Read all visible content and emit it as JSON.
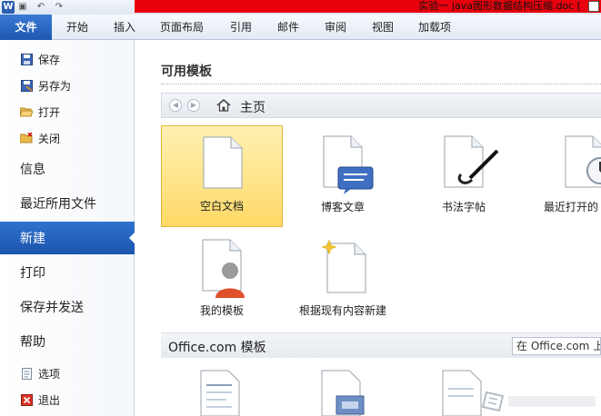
{
  "window": {
    "app_icon_letter": "W",
    "title": "实验一 java图形数据结构压缩.doc [",
    "accent_red": "#e8000c"
  },
  "quick_access": [
    "save-icon",
    "undo-icon",
    "redo-icon"
  ],
  "ribbon": {
    "tabs": [
      "文件",
      "开始",
      "插入",
      "页面布局",
      "引用",
      "邮件",
      "审阅",
      "视图",
      "加载项"
    ]
  },
  "sidebar": {
    "top_items": [
      {
        "label": "保存",
        "icon": "save-icon"
      },
      {
        "label": "另存为",
        "icon": "save-as-icon"
      },
      {
        "label": "打开",
        "icon": "open-folder-icon"
      },
      {
        "label": "关闭",
        "icon": "close-folder-icon"
      }
    ],
    "sections": [
      "信息",
      "最近所用文件",
      "新建",
      "打印",
      "保存并发送",
      "帮助"
    ],
    "active": "新建",
    "bottom_items": [
      {
        "label": "选项",
        "icon": "options-icon"
      },
      {
        "label": "退出",
        "icon": "exit-icon"
      }
    ]
  },
  "main": {
    "available_templates": "可用模板",
    "nav": {
      "home": "主页"
    },
    "templates": [
      {
        "label": "空白文档",
        "icon": "blank-document-icon",
        "selected": true
      },
      {
        "label": "博客文章",
        "icon": "blog-post-icon",
        "selected": false
      },
      {
        "label": "书法字帖",
        "icon": "calligraphy-icon",
        "selected": false
      },
      {
        "label": "最近打开的",
        "icon": "recent-templates-icon",
        "selected": false
      },
      {
        "label": "我的模板",
        "icon": "my-templates-icon",
        "selected": false
      },
      {
        "label": "根据现有内容新建",
        "icon": "new-from-existing-icon",
        "selected": false
      }
    ],
    "office_section": {
      "title": "Office.com 模板",
      "search_placeholder": "在 Office.com 上"
    }
  }
}
